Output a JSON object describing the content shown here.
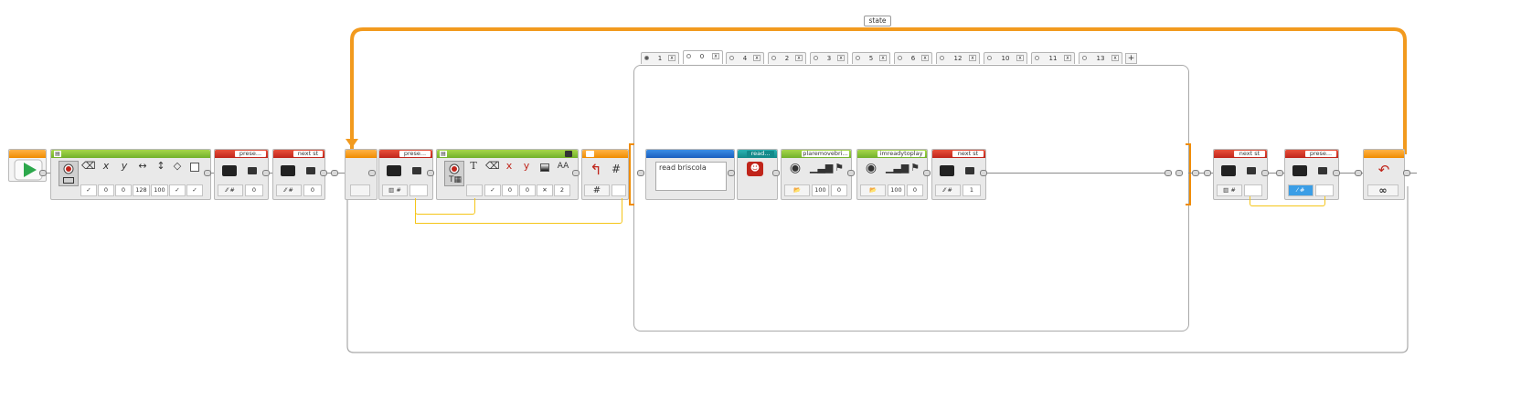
{
  "colors": {
    "action_green": "#72b12b",
    "data_red": "#c0251b",
    "flow_orange": "#f08c00",
    "wire_yellow": "#f5c518",
    "loop_orange": "#f29a1e",
    "custom_blue": "#1b5fbf",
    "custom_teal": "#138a8a"
  },
  "loop_top": {
    "label": "state"
  },
  "display_block": {
    "values": [
      "0",
      "0",
      "128",
      "100"
    ],
    "letters": [
      "x",
      "y"
    ]
  },
  "var_block_1": {
    "name": "prese...",
    "value": "0"
  },
  "var_block_2": {
    "name": "next st",
    "value": "0"
  },
  "var_block_3": {
    "name": "prese..."
  },
  "text_block": {
    "values": [
      "0",
      "0",
      "2"
    ]
  },
  "switch": {
    "tabs": [
      "1",
      "0",
      "4",
      "2",
      "3",
      "5",
      "6",
      "12",
      "10",
      "11",
      "13"
    ],
    "add": "+",
    "close": "x",
    "active_tab": "0",
    "default_tab": "1"
  },
  "comment": {
    "text": "read briscola"
  },
  "myblock_read": {
    "name": "read..."
  },
  "sound_1": {
    "name": "plaremovebri...",
    "values": [
      "100",
      "0"
    ]
  },
  "sound_2": {
    "name": "imreadytoplay",
    "values": [
      "100",
      "0"
    ]
  },
  "var_block_4": {
    "name": "next st",
    "value": "1"
  },
  "var_block_5": {
    "name": "next st"
  },
  "var_block_6": {
    "name": "prese..."
  },
  "loop_end": {
    "symbol": "∞"
  }
}
